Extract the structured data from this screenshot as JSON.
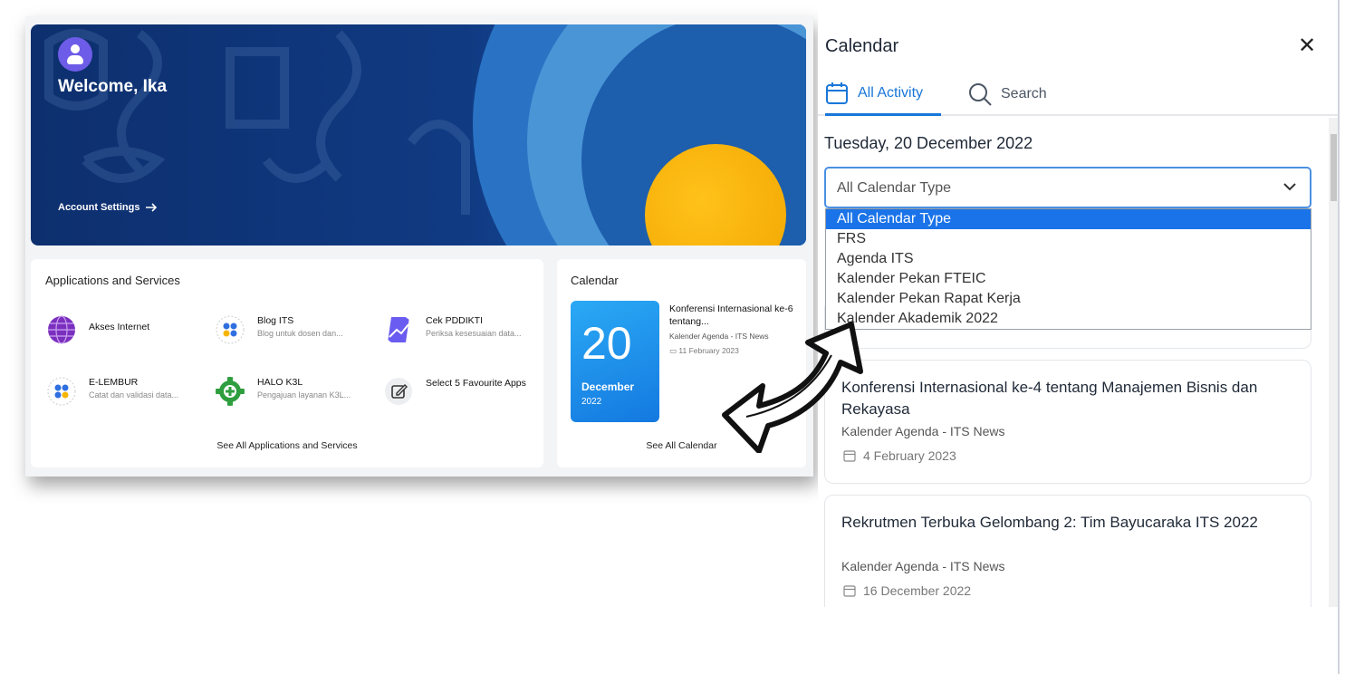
{
  "dashboard": {
    "welcome": "Welcome, Ika",
    "account_settings": "Account Settings",
    "apps_title": "Applications and Services",
    "apps": [
      {
        "name": "Akses Internet",
        "desc": "",
        "icon": "globe-icon",
        "color": "#7b2fbf"
      },
      {
        "name": "Blog ITS",
        "desc": "Blog untuk dosen dan...",
        "icon": "dots-grid-icon",
        "color": "#e8eaf6"
      },
      {
        "name": "Cek PDDIKTI",
        "desc": "Periksa kesesuaian data...",
        "icon": "chart-badge-icon",
        "color": "#6a5cf0"
      },
      {
        "name": "E-LEMBUR",
        "desc": "Catat dan validasi data...",
        "icon": "dots-grid-icon",
        "color": "#e8eaf6"
      },
      {
        "name": "HALO K3L",
        "desc": "Pengajuan layanan K3L...",
        "icon": "gear-plus-icon",
        "color": "#2e9e3e"
      },
      {
        "name": "Select 5 Favourite Apps",
        "desc": "",
        "icon": "edit-icon",
        "color": "#eceef2"
      }
    ],
    "apps_see_all": "See All Applications and Services",
    "calendar_title": "Calendar",
    "cal_day": "20",
    "cal_month": "December",
    "cal_year": "2022",
    "cal_event_title": "Konferensi Internasional ke-6 tentang...",
    "cal_event_source": "Kalender Agenda - ITS News",
    "cal_event_date": "11 February 2023",
    "cal_prev": "‹",
    "cal_next": "›",
    "cal_see_all": "See All Calendar"
  },
  "panel": {
    "title": "Calendar",
    "close": "✕",
    "tabs": [
      {
        "label": "All Activity",
        "icon": "calendar-icon"
      },
      {
        "label": "Search",
        "icon": "search-icon"
      }
    ],
    "date_heading": "Tuesday, 20 December 2022",
    "select_value": "All Calendar Type",
    "options": [
      "All Calendar Type",
      "FRS",
      "Agenda ITS",
      "Kalender Pekan FTEIC",
      "Kalender Pekan Rapat Kerja",
      "Kalender Akademik 2022"
    ],
    "events": [
      {
        "title": "Konferensi Internasional ke-4 tentang Manajemen Bisnis dan Rekayasa",
        "source": "Kalender Agenda - ITS News",
        "date": "4 February 2023"
      },
      {
        "title": "Rekrutmen Terbuka Gelombang 2: Tim Bayucaraka ITS 2022",
        "source": "Kalender Agenda - ITS News",
        "date": "16 December 2022"
      }
    ],
    "accent": "#1877d9"
  }
}
